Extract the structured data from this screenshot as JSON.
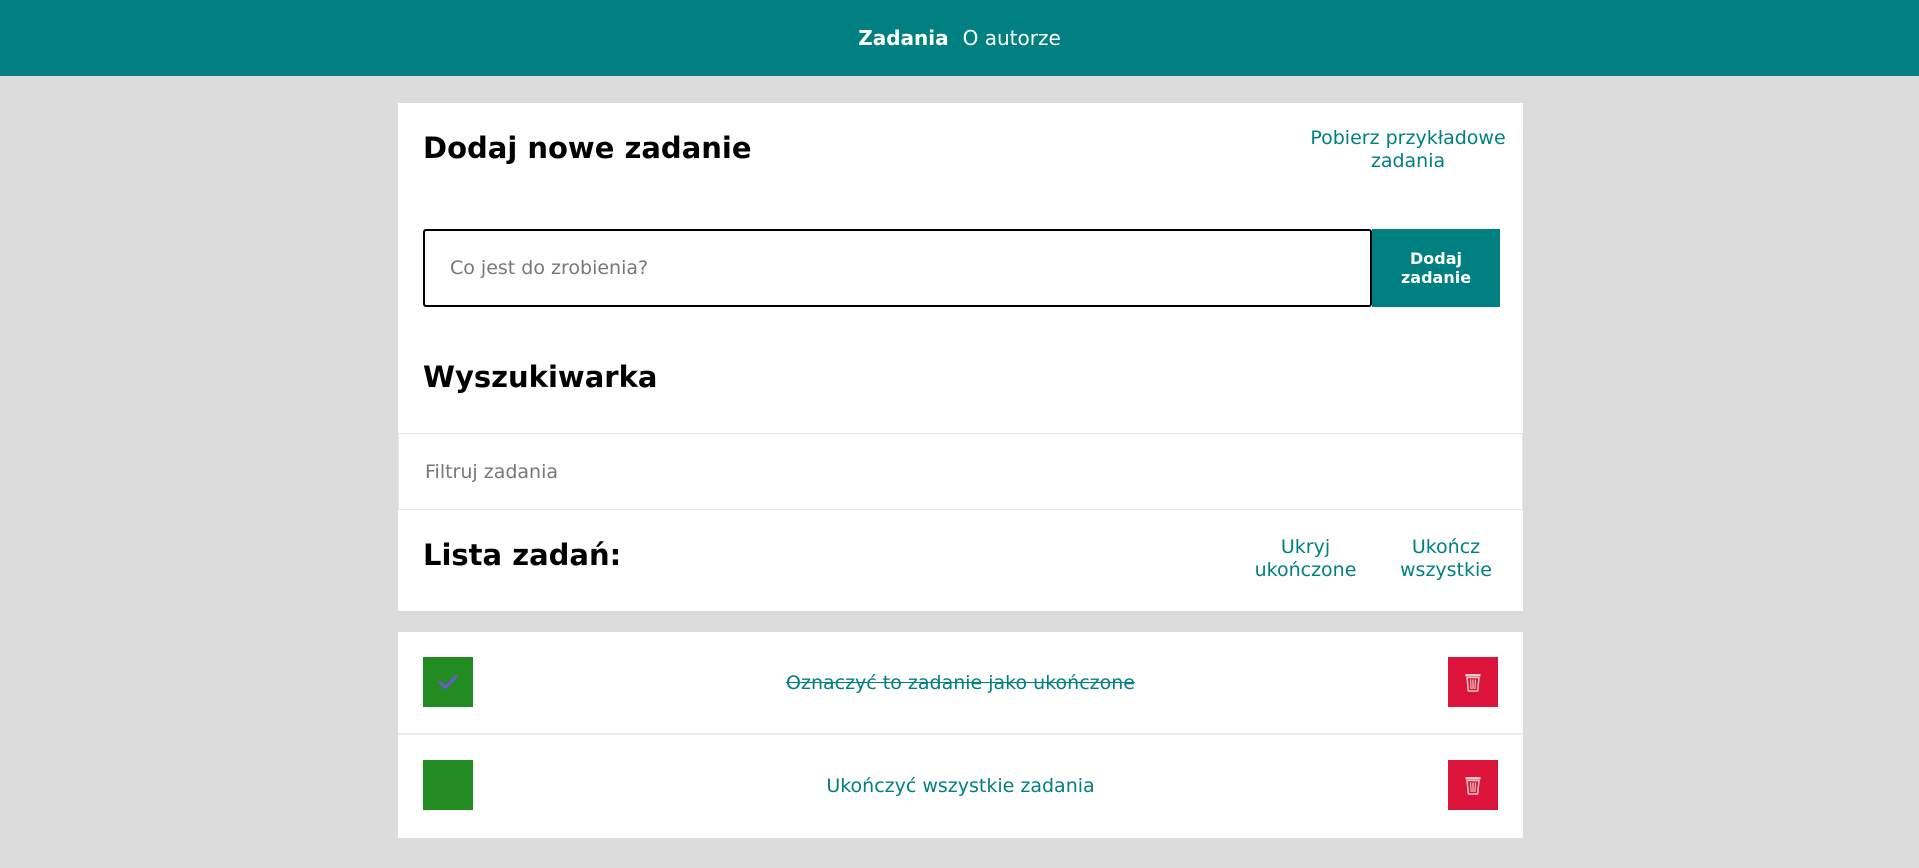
{
  "nav": {
    "tasks": "Zadania",
    "about": "O autorze"
  },
  "add_section": {
    "title": "Dodaj nowe zadanie",
    "sample_link": "Pobierz przykładowe zadania",
    "input_placeholder": "Co jest do zrobienia?",
    "add_button": "Dodaj zadanie"
  },
  "search_section": {
    "title": "Wyszukiwarka",
    "filter_placeholder": "Filtruj zadania"
  },
  "list_section": {
    "title": "Lista zadań:",
    "hide_completed": "Ukryj ukończone",
    "complete_all": "Ukończ wszystkie"
  },
  "tasks": [
    {
      "text": "Oznaczyć to zadanie jako ukończone",
      "done": true
    },
    {
      "text": "Ukończyć wszystkie zadania",
      "done": false
    }
  ],
  "colors": {
    "accent": "#008080",
    "background": "#dcdcdc",
    "check": "#228b22",
    "checkmark": "#6a5acd",
    "delete": "#dc143c"
  },
  "icons": {
    "checkmark": "checkmark-icon",
    "delete": "trash-icon"
  }
}
